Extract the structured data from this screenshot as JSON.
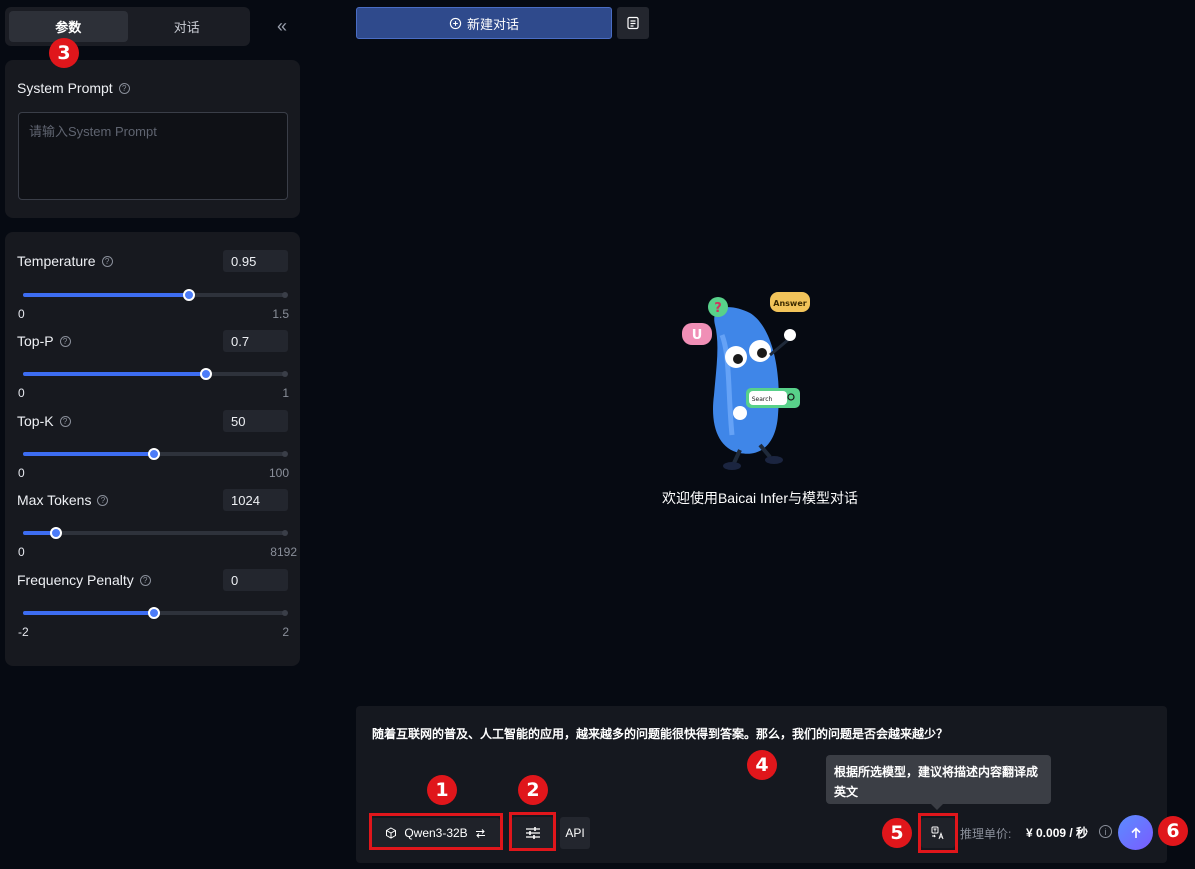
{
  "left_panel": {
    "tabs": [
      {
        "label": "参数",
        "active": true
      },
      {
        "label": "对话",
        "active": false
      }
    ],
    "collapse_icon": "double-chevron-left-icon"
  },
  "system_prompt": {
    "label": "System Prompt",
    "placeholder": "请输入System Prompt",
    "value": ""
  },
  "params": {
    "temperature": {
      "label": "Temperature",
      "value": "0.95",
      "min": "0",
      "max": "1.5",
      "fraction": 0.633
    },
    "top_p": {
      "label": "Top-P",
      "value": "0.7",
      "min": "0",
      "max": "1",
      "fraction": 0.7
    },
    "top_k": {
      "label": "Top-K",
      "value": "50",
      "min": "0",
      "max": "100",
      "fraction": 0.5
    },
    "max_tokens": {
      "label": "Max Tokens",
      "value": "1024",
      "min": "0",
      "max": "8192",
      "fraction": 0.125
    },
    "frequency_penalty": {
      "label": "Frequency Penalty",
      "value": "0",
      "min": "-2",
      "max": "2",
      "fraction": 0.5
    }
  },
  "header": {
    "new_chat_label": "新建对话"
  },
  "welcome": {
    "text": "欢迎使用Baicai Infer与模型对话",
    "mascot_bubbles": {
      "answer": "Answer",
      "search": "Search",
      "question": "?",
      "u": "U"
    }
  },
  "composer": {
    "prompt": "随着互联网的普及、人工智能的应用，越来越多的问题能很快得到答案。那么，我们的问题是否会越来越少？",
    "model_label": "Qwen3-32B",
    "api_label": "API",
    "price_label": "推理单价:",
    "price_value": "¥ 0.009 / 秒",
    "tooltip": "根据所选模型，建议将描述内容翻译成英文"
  },
  "annotations": [
    "1",
    "2",
    "3",
    "4",
    "5",
    "6"
  ],
  "colors": {
    "accent": "#3d6df2",
    "highlight_red": "#e0161b",
    "background": "#060a12",
    "panel": "#17191f"
  }
}
